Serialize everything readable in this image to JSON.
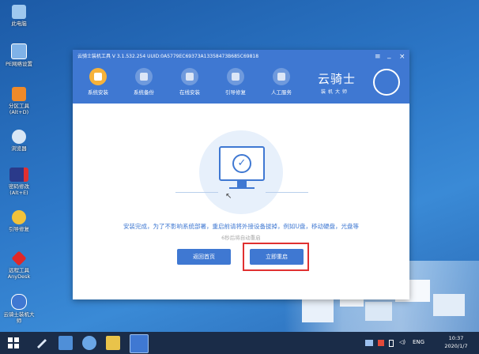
{
  "desktop": {
    "icons": [
      {
        "label": "此电脑"
      },
      {
        "label": "PE网络设置"
      },
      {
        "label": "分区工具\n(Alt+D)"
      },
      {
        "label": "浏览器"
      },
      {
        "label": "密码修改\n(Alt+E)"
      },
      {
        "label": "引导修复"
      },
      {
        "label": "远程工具\nAnyDesk"
      },
      {
        "label": "云骑士装机大\n师"
      }
    ]
  },
  "window": {
    "title": "云骑士装机工具 V 3.1.532.254 UUID:0A5779EC69373A13358473B685C69818",
    "controls": {
      "menu": "≡",
      "minimize": "_",
      "close": "×"
    },
    "nav": [
      {
        "label": "系统安装",
        "icon": "system-install-icon",
        "active": true
      },
      {
        "label": "系统备份",
        "icon": "system-backup-icon",
        "active": false
      },
      {
        "label": "在线安装",
        "icon": "online-install-icon",
        "active": false
      },
      {
        "label": "引导修复",
        "icon": "boot-repair-icon",
        "active": false
      },
      {
        "label": "人工服务",
        "icon": "support-chat-icon",
        "active": false
      }
    ],
    "brand": {
      "name": "云骑士",
      "subtitle": "装机大师"
    },
    "content": {
      "message": "安装完成，为了不影响系统部署，重启前请将外接设备拔掉，例如U盘，移动硬盘，光盘等",
      "countdown": "6秒后将自动重启",
      "back_button": "返回首页",
      "restart_button": "立即重启"
    }
  },
  "taskbar": {
    "tray_lang": "ENG",
    "time": "10:37",
    "date": "2020/1/7"
  },
  "colors": {
    "accent": "#3f78d2",
    "active_tab": "#f6b23a",
    "highlight_box": "#e03030",
    "taskbar": "#1a2c48"
  }
}
